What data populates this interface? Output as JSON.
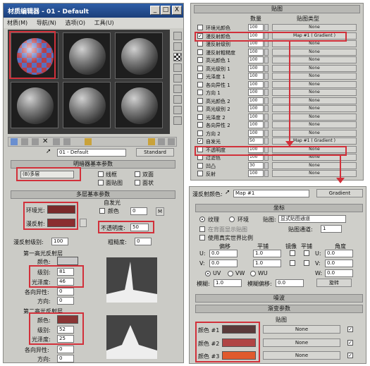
{
  "editor": {
    "title": "材质编辑器 - 01 - Default",
    "menu": [
      "材质(M)",
      "导航(N)",
      "选项(O)",
      "工具(U)"
    ],
    "win_min": "_",
    "win_max": "□",
    "win_close": "X",
    "material_name": "01 - Default",
    "material_type": "Standard"
  },
  "shader_rollout": {
    "title": "明暗器基本参数",
    "shader": "(B)多层",
    "options": [
      "线框",
      "双面",
      "面贴图",
      "面状"
    ]
  },
  "multilayer_rollout": {
    "title": "多层基本参数",
    "ambient_label": "环境光:",
    "diffuse_label": "漫反射:",
    "self_illum_label": "自发光",
    "color_label": "颜色",
    "self_illum_value": "0",
    "opacity_label": "不透明度:",
    "opacity_value": "50",
    "diffuse_level_label": "漫反射级别:",
    "diffuse_level_value": "100",
    "roughness_label": "粗糙度:",
    "roughness_value": "0",
    "spec1_title": "第一高光反射层",
    "spec1_color_label": "颜色:",
    "spec1_level_label": "级别:",
    "spec1_level": "81",
    "spec1_gloss_label": "光泽度:",
    "spec1_gloss": "46",
    "spec1_aniso_label": "各向异性:",
    "spec1_aniso": "0",
    "spec1_orient_label": "方向:",
    "spec1_orient": "0",
    "spec2_title": "第二高光反射层",
    "spec2_color_label": "颜色:",
    "spec2_level_label": "级别:",
    "spec2_level": "52",
    "spec2_gloss_label": "光泽度:",
    "spec2_gloss": "25",
    "spec2_aniso_label": "各向异性:",
    "spec2_aniso": "0",
    "spec2_orient_label": "方向:",
    "spec2_orient": "0",
    "lock_label": "M"
  },
  "maps_rollout": {
    "title": "贴图",
    "col_amount": "数量",
    "col_type": "贴图类型",
    "rows": [
      {
        "name": "环境光颜色",
        "amount": "100",
        "map": "None",
        "checked": false
      },
      {
        "name": "漫反射颜色",
        "amount": "100",
        "map": "Map #1  ( Gradient )",
        "checked": true
      },
      {
        "name": "漫反射级别",
        "amount": "100",
        "map": "None",
        "checked": false
      },
      {
        "name": "漫反射粗糙度",
        "amount": "100",
        "map": "None",
        "checked": false
      },
      {
        "name": "高光颜色 1",
        "amount": "100",
        "map": "None",
        "checked": false
      },
      {
        "name": "高光级别 1",
        "amount": "100",
        "map": "None",
        "checked": false
      },
      {
        "name": "光泽度 1",
        "amount": "100",
        "map": "None",
        "checked": false
      },
      {
        "name": "各向异性 1",
        "amount": "100",
        "map": "None",
        "checked": false
      },
      {
        "name": "方向 1",
        "amount": "100",
        "map": "None",
        "checked": false
      },
      {
        "name": "高光颜色 2",
        "amount": "100",
        "map": "None",
        "checked": false
      },
      {
        "name": "高光级别 2",
        "amount": "100",
        "map": "None",
        "checked": false
      },
      {
        "name": "光泽度 2",
        "amount": "100",
        "map": "None",
        "checked": false
      },
      {
        "name": "各向异性 2",
        "amount": "100",
        "map": "None",
        "checked": false
      },
      {
        "name": "方向 2",
        "amount": "100",
        "map": "None",
        "checked": false
      },
      {
        "name": "自发光",
        "amount": "50",
        "map": "Map #1  ( Gradient )",
        "checked": true
      },
      {
        "name": "不透明度",
        "amount": "100",
        "map": "None",
        "checked": false
      },
      {
        "name": "过滤色",
        "amount": "100",
        "map": "None",
        "checked": false
      },
      {
        "name": "凹凸",
        "amount": "30",
        "map": "None",
        "checked": false
      },
      {
        "name": "反射",
        "amount": "100",
        "map": "None",
        "checked": false
      }
    ]
  },
  "gradient_panel": {
    "slot_label": "漫反射颜色:",
    "map_name": "Map #1",
    "map_type": "Gradient",
    "coords_title": "坐标",
    "texture_label": "纹理",
    "env_label": "环境",
    "mapping_label": "贴图:",
    "mapping_value": "显式贴图通道",
    "show_map_back": "在背面显示贴图",
    "real_world": "使用真实世界比例",
    "map_channel_label": "贴图通道:",
    "map_channel": "1",
    "offset_label": "偏移",
    "tiling_label": "平铺",
    "mirror_label": "镜像",
    "tile_label": "平铺",
    "angle_label": "角度",
    "u_offset": "0.0",
    "u_tiling": "1.0",
    "v_offset": "0.0",
    "v_tiling": "1.0",
    "u_angle": "0.0",
    "v_angle": "0.0",
    "w_angle": "0.0",
    "u_row": "U:",
    "v_row": "V:",
    "w_row": "W:",
    "uv_options": [
      "UV",
      "VW",
      "WU"
    ],
    "blur_label": "模糊:",
    "blur": "1.0",
    "blur_offset_label": "模糊偏移:",
    "blur_offset": "0.0",
    "rotate": "旋转",
    "noise_title": "噪波",
    "gradient_title": "渐变参数",
    "maps_col": "贴图",
    "color1_label": "颜色 #1",
    "color2_label": "颜色 #2",
    "color3_label": "颜色 #3",
    "none": "None",
    "color1": "#5a3a3a",
    "color2": "#b04444",
    "color3": "#e05a2e"
  },
  "colors": {
    "ambient": "#7a2a2a",
    "diffuse": "#8a2e30",
    "spec1": "#c9c9c9",
    "spec2": "#8a3434",
    "highlight": "#d2303a"
  }
}
